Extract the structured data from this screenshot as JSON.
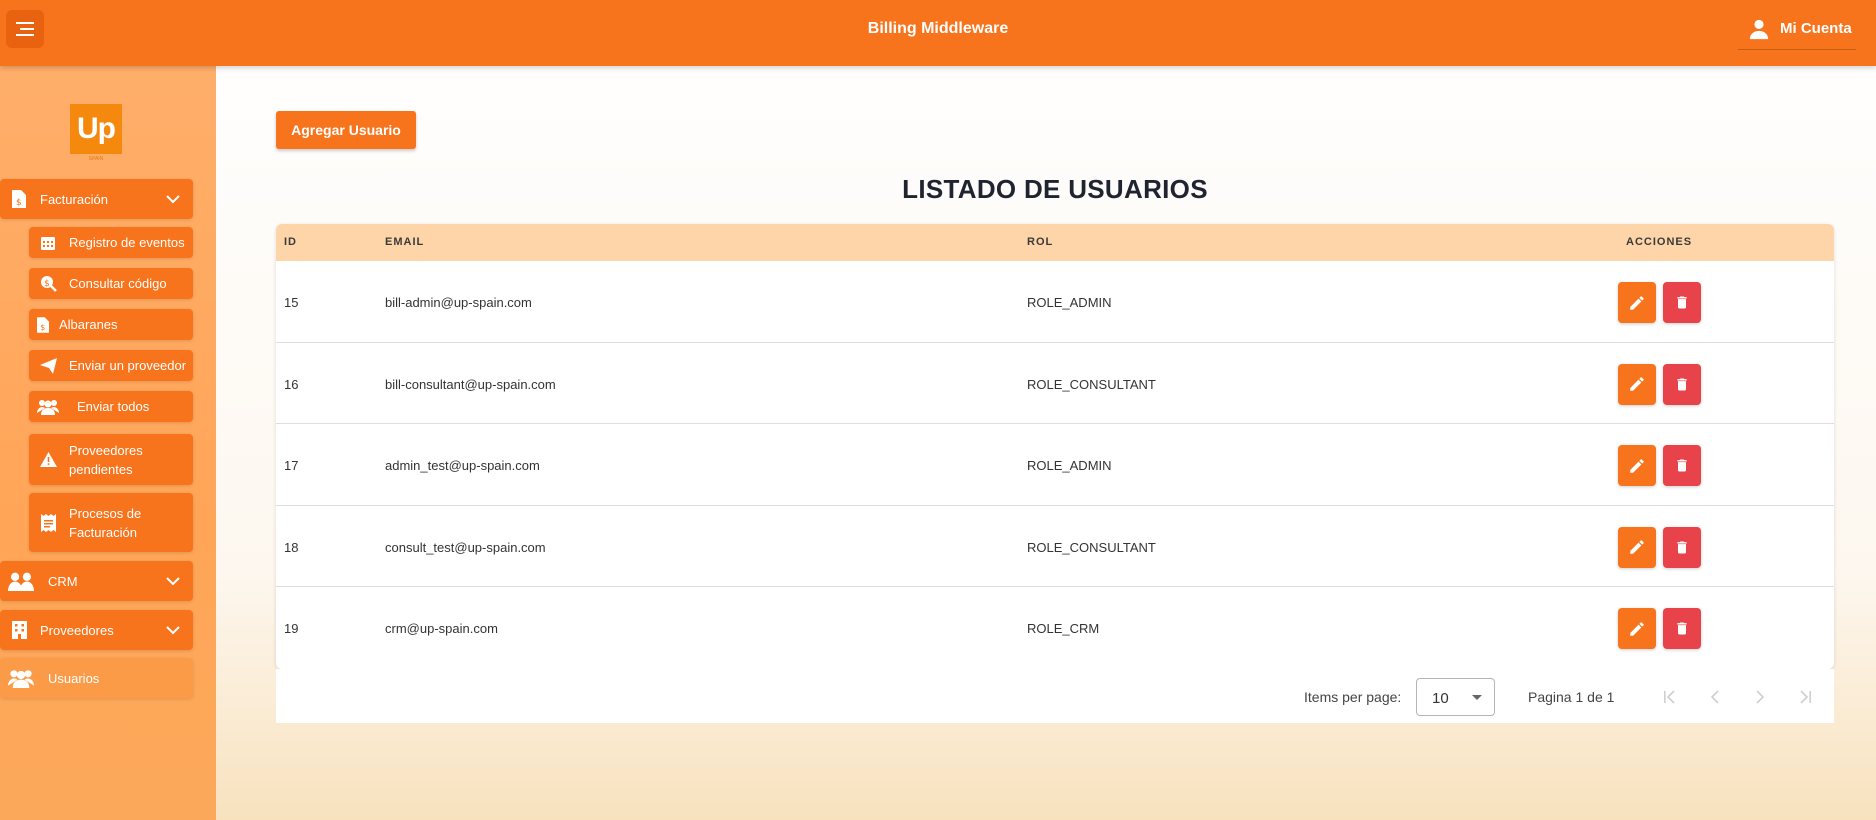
{
  "header": {
    "title": "Billing Middleware",
    "account_label": "Mi Cuenta"
  },
  "sidebar": {
    "logo_text": "Up",
    "logo_subtext": "SPAIN",
    "groups": [
      {
        "label": "Facturación",
        "expanded": true
      },
      {
        "label": "CRM",
        "expanded": false
      },
      {
        "label": "Proveedores",
        "expanded": false
      },
      {
        "label": "Usuarios"
      }
    ],
    "facturacion_items": [
      {
        "label": "Registro de eventos",
        "icon": "calendar-icon"
      },
      {
        "label": "Consultar código",
        "icon": "dollar-search-icon"
      },
      {
        "label": "Albaranes",
        "icon": "invoice-icon"
      },
      {
        "label": "Enviar un proveedor",
        "icon": "send-icon"
      },
      {
        "label": "Enviar todos",
        "icon": "users-icon"
      },
      {
        "label": "Proveedores pendientes",
        "icon": "warning-icon"
      },
      {
        "label": "Procesos de Facturación",
        "icon": "receipt-icon"
      }
    ]
  },
  "main": {
    "add_button": "Agregar Usuario",
    "title": "LISTADO DE USUARIOS",
    "columns": [
      "ID",
      "EMAIL",
      "ROL",
      "ACCIONES"
    ],
    "rows": [
      {
        "id": "15",
        "email": "bill-admin@up-spain.com",
        "rol": "ROLE_ADMIN"
      },
      {
        "id": "16",
        "email": "bill-consultant@up-spain.com",
        "rol": "ROLE_CONSULTANT"
      },
      {
        "id": "17",
        "email": "admin_test@up-spain.com",
        "rol": "ROLE_ADMIN"
      },
      {
        "id": "18",
        "email": "consult_test@up-spain.com",
        "rol": "ROLE_CONSULTANT"
      },
      {
        "id": "19",
        "email": "crm@up-spain.com",
        "rol": "ROLE_CRM"
      }
    ],
    "paginator": {
      "items_per_page_label": "Items per page:",
      "items_per_page": "10",
      "range_label": "Pagina 1 de 1"
    }
  },
  "colors": {
    "accent": "#f7731c",
    "danger": "#e8424a",
    "table_header": "#fed5a8",
    "sidebar": "#ffa558"
  }
}
